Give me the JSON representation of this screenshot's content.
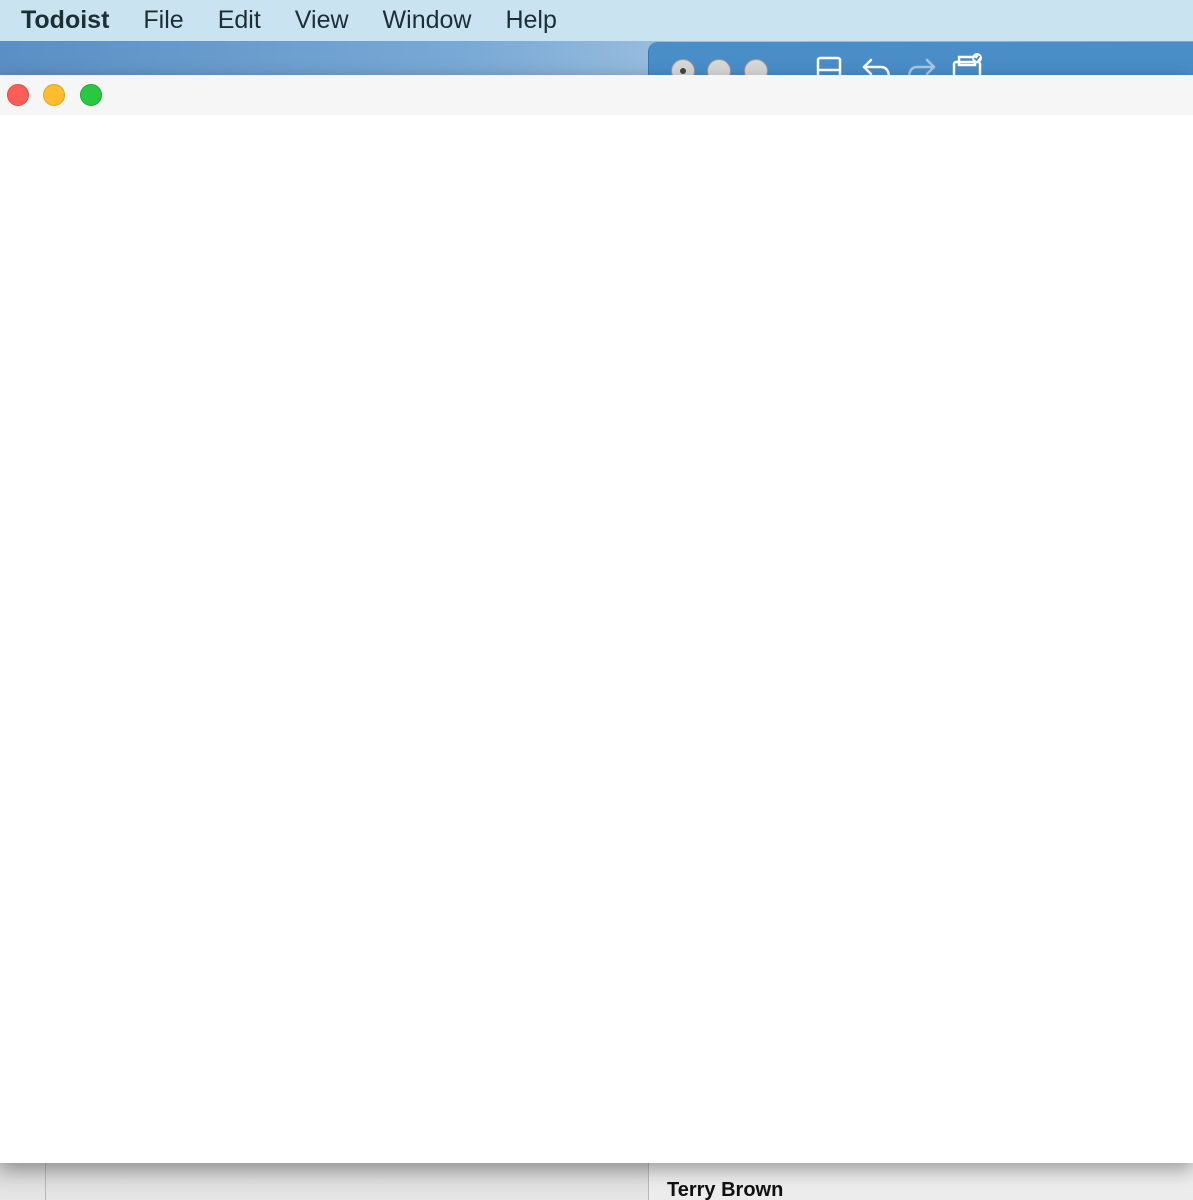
{
  "menubar": {
    "app_name": "Todoist",
    "items": [
      "File",
      "Edit",
      "View",
      "Window",
      "Help"
    ]
  },
  "background_window": {
    "toolbar_icons": [
      "save-icon",
      "undo-icon",
      "redo-icon",
      "print-icon"
    ]
  },
  "window": {
    "traffic_lights": [
      "close",
      "minimize",
      "zoom"
    ]
  },
  "bottom_window": {
    "contact_name": "Terry Brown"
  },
  "colors": {
    "menubar_bg": "#c9e3f1",
    "close": "#fd5f57",
    "minimize": "#febc2e",
    "zoom": "#28c840",
    "desktop_blue": "#4a8ec8"
  }
}
